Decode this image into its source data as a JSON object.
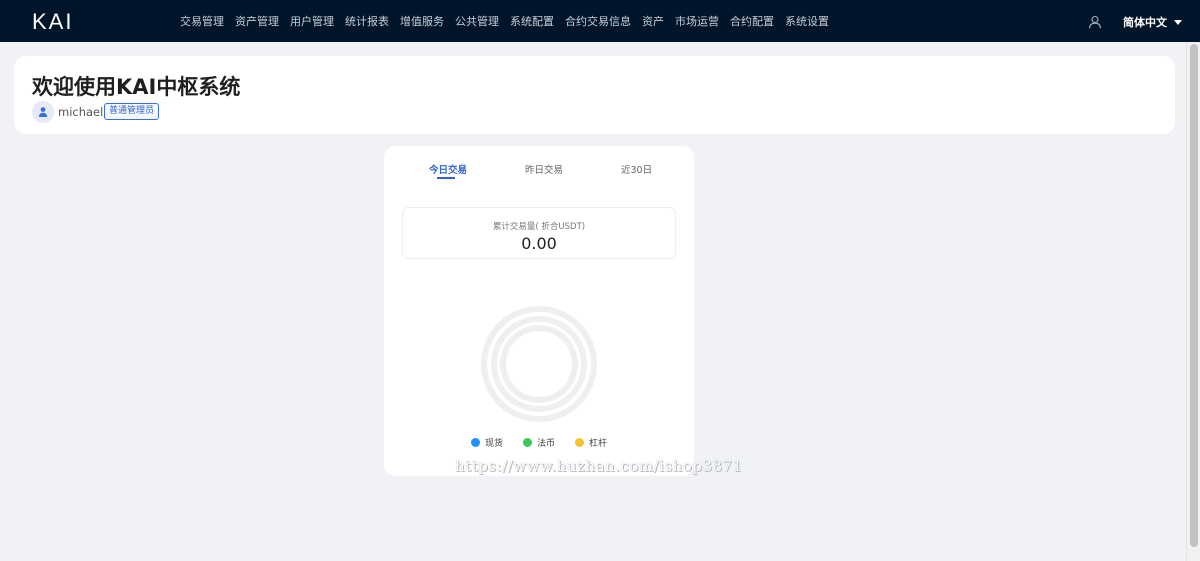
{
  "header": {
    "logo": "KAI",
    "nav": [
      "交易管理",
      "资产管理",
      "用户管理",
      "统计报表",
      "增值服务",
      "公共管理",
      "系统配置",
      "合约交易信息",
      "资产",
      "市场运营",
      "合约配置",
      "系统设置"
    ],
    "language": "简体中文",
    "user_icon": "user-outline-icon"
  },
  "welcome": {
    "title": "欢迎使用KAI中枢系统",
    "username": "michael",
    "role": "普通管理员"
  },
  "stats": {
    "tabs": [
      "今日交易",
      "昨日交易",
      "近30日"
    ],
    "active_tab": 0,
    "volume_label": "累计交易量( 折合USDT)",
    "volume_value": "0.00",
    "legend": [
      {
        "label": "现货",
        "color": "#1e90ff"
      },
      {
        "label": "法币",
        "color": "#3cc85a"
      },
      {
        "label": "杠杆",
        "color": "#f7c22e"
      }
    ]
  },
  "watermark": "https://www.huzhan.com/ishop3871"
}
